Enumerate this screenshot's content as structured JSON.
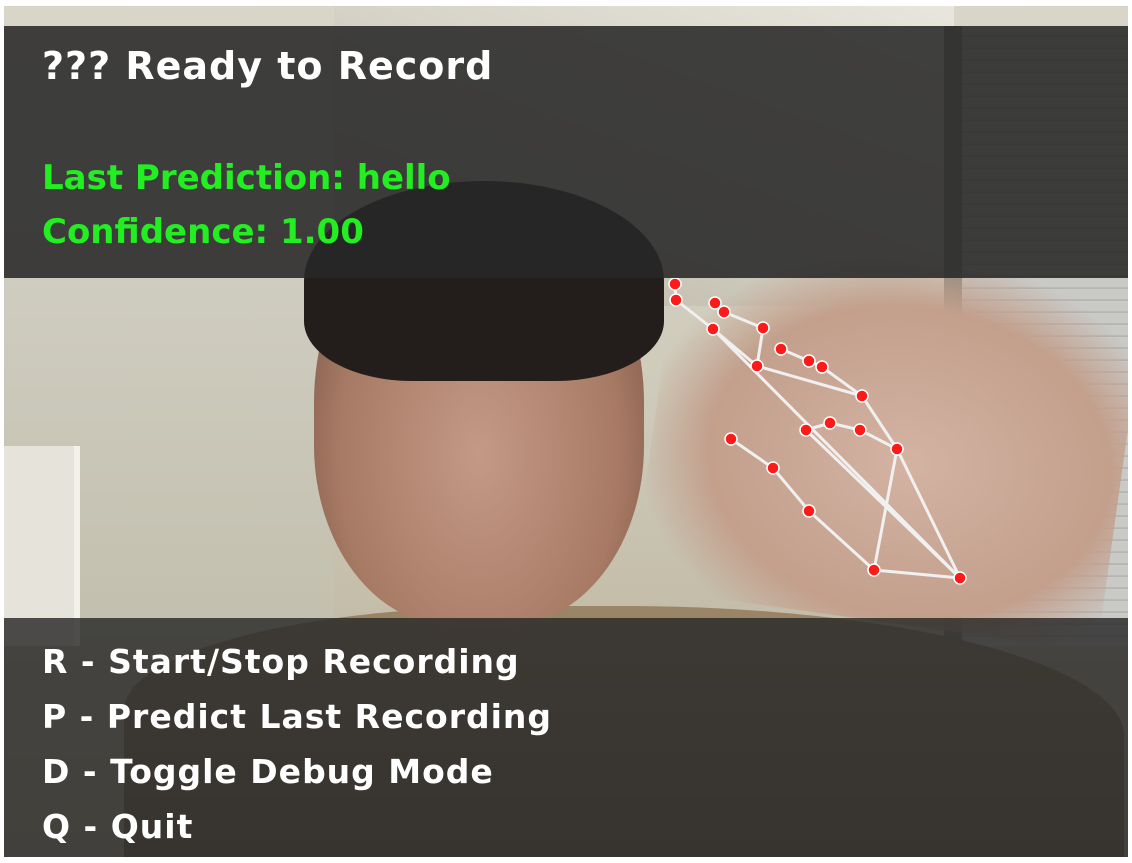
{
  "status": {
    "title": "??? Ready to Record",
    "last_prediction": "Last Prediction: hello",
    "confidence": "Confidence: 1.00"
  },
  "controls": [
    "R - Start/Stop Recording",
    "P - Predict Last Recording",
    "D - Toggle Debug Mode",
    "Q - Quit"
  ],
  "colors": {
    "status_text": "#ffffff",
    "prediction_text": "#22ee22",
    "landmark_point": "#ff1a1a",
    "landmark_line": "#f0f0f0"
  }
}
